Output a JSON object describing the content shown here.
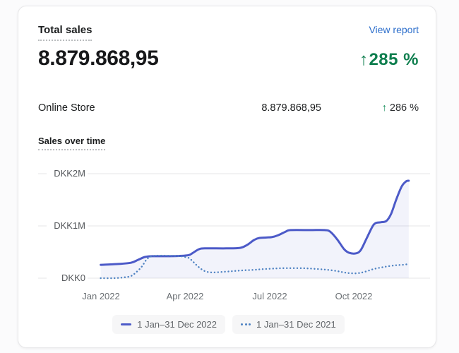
{
  "card": {
    "title": "Total sales",
    "view_report_label": "View report",
    "total_value": "8.879.868,95",
    "total_change": "285 %",
    "arrow_up": "↑",
    "breakdown": [
      {
        "channel": "Online Store",
        "value": "8.879.868,95",
        "change": "286 %"
      }
    ],
    "chart_heading": "Sales over time"
  },
  "colors": {
    "link_blue": "#2c6ecb",
    "positive_green": "#0e7e4e",
    "line_2022": "#4c5ac8",
    "line_2021": "#4e82c2",
    "gridline": "#e9eaec",
    "area_fill": "rgba(76,90,200,0.07)"
  },
  "chart_data": {
    "type": "line",
    "title": "Sales over time",
    "currency": "DKK",
    "grid": "horizontal",
    "legend_position": "bottom",
    "xlim_months": [
      0,
      12.05
    ],
    "ylim": [
      0,
      2270000
    ],
    "y_ticks": [
      {
        "label": "DKK0",
        "value": 0
      },
      {
        "label": "DKK1M",
        "value": 1000000
      },
      {
        "label": "DKK2M",
        "value": 2000000
      }
    ],
    "x_ticks": [
      {
        "label": "Jan 2022",
        "month": 0
      },
      {
        "label": "Apr 2022",
        "month": 3
      },
      {
        "label": "Jul 2022",
        "month": 6
      },
      {
        "label": "Oct 2022",
        "month": 9
      }
    ],
    "series": [
      {
        "name": "1 Jan–31 Dec 2022",
        "style": "solid",
        "color": "#4c5ac8",
        "area_fill": true,
        "points_month_value": [
          [
            0,
            255000
          ],
          [
            0.58,
            270000
          ],
          [
            1.08,
            295000
          ],
          [
            1.33,
            350000
          ],
          [
            1.58,
            405000
          ],
          [
            1.84,
            420000
          ],
          [
            2.46,
            420000
          ],
          [
            2.97,
            430000
          ],
          [
            3.17,
            445000
          ],
          [
            3.34,
            500000
          ],
          [
            3.52,
            555000
          ],
          [
            3.72,
            570000
          ],
          [
            4.48,
            570000
          ],
          [
            4.98,
            580000
          ],
          [
            5.23,
            635000
          ],
          [
            5.48,
            730000
          ],
          [
            5.68,
            770000
          ],
          [
            6.11,
            785000
          ],
          [
            6.36,
            825000
          ],
          [
            6.61,
            890000
          ],
          [
            6.79,
            920000
          ],
          [
            7.49,
            920000
          ],
          [
            8.0,
            920000
          ],
          [
            8.2,
            890000
          ],
          [
            8.45,
            745000
          ],
          [
            8.7,
            555000
          ],
          [
            8.88,
            485000
          ],
          [
            9.13,
            475000
          ],
          [
            9.3,
            540000
          ],
          [
            9.5,
            755000
          ],
          [
            9.71,
            985000
          ],
          [
            9.83,
            1055000
          ],
          [
            10.01,
            1070000
          ],
          [
            10.21,
            1095000
          ],
          [
            10.38,
            1230000
          ],
          [
            10.56,
            1500000
          ],
          [
            10.76,
            1755000
          ],
          [
            10.91,
            1850000
          ],
          [
            11.01,
            1865000
          ]
        ]
      },
      {
        "name": "1 Jan–31 Dec 2021",
        "style": "dotted",
        "color": "#4e82c2",
        "area_fill": false,
        "points_month_value": [
          [
            0,
            0
          ],
          [
            0.45,
            0
          ],
          [
            0.83,
            15000
          ],
          [
            1.08,
            40000
          ],
          [
            1.26,
            110000
          ],
          [
            1.46,
            215000
          ],
          [
            1.63,
            350000
          ],
          [
            1.76,
            405000
          ],
          [
            1.96,
            430000
          ],
          [
            2.46,
            430000
          ],
          [
            2.84,
            420000
          ],
          [
            3.02,
            405000
          ],
          [
            3.17,
            380000
          ],
          [
            3.34,
            295000
          ],
          [
            3.52,
            205000
          ],
          [
            3.72,
            135000
          ],
          [
            3.97,
            110000
          ],
          [
            4.35,
            120000
          ],
          [
            4.73,
            135000
          ],
          [
            5.1,
            150000
          ],
          [
            5.48,
            160000
          ],
          [
            5.86,
            175000
          ],
          [
            6.49,
            190000
          ],
          [
            7.24,
            190000
          ],
          [
            7.74,
            175000
          ],
          [
            8.12,
            160000
          ],
          [
            8.45,
            135000
          ],
          [
            8.7,
            110000
          ],
          [
            8.93,
            95000
          ],
          [
            9.18,
            95000
          ],
          [
            9.43,
            120000
          ],
          [
            9.76,
            175000
          ],
          [
            10.13,
            215000
          ],
          [
            10.51,
            245000
          ],
          [
            10.81,
            257000
          ],
          [
            11.01,
            270000
          ]
        ]
      }
    ]
  }
}
